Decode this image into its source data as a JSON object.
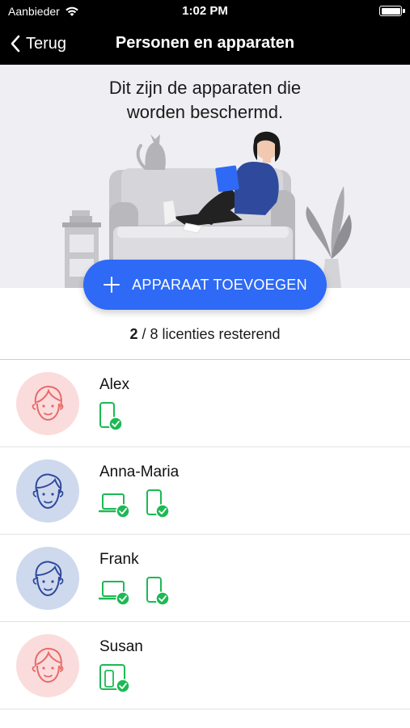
{
  "status_bar": {
    "carrier": "Aanbieder",
    "time": "1:02 PM",
    "battery_level": 1.0
  },
  "nav": {
    "back_label": "Terug",
    "title": "Personen en apparaten"
  },
  "hero": {
    "text_line1": "Dit zijn de apparaten die",
    "text_line2": "worden beschermd."
  },
  "add_button": {
    "label": "APPARAAT TOEVOEGEN",
    "icon": "plus-icon"
  },
  "licenses": {
    "used": "2",
    "rest": " / 8 licenties resterend"
  },
  "colors": {
    "primary": "#2e6af5",
    "device_green": "#1db954",
    "avatar_pink": "#fbdcdc",
    "avatar_blue": "#cfd9ee",
    "face_pink": "#e86a6a",
    "face_blue": "#2f4a9c"
  },
  "people": [
    {
      "name": "Alex",
      "avatar": "female",
      "devices": [
        "phone-icon"
      ]
    },
    {
      "name": "Anna-Maria",
      "avatar": "male",
      "devices": [
        "laptop-icon",
        "phone-icon"
      ]
    },
    {
      "name": "Frank",
      "avatar": "male",
      "devices": [
        "laptop-icon",
        "phone-icon"
      ]
    },
    {
      "name": "Susan",
      "avatar": "female",
      "devices": [
        "tablet-icon"
      ]
    }
  ]
}
